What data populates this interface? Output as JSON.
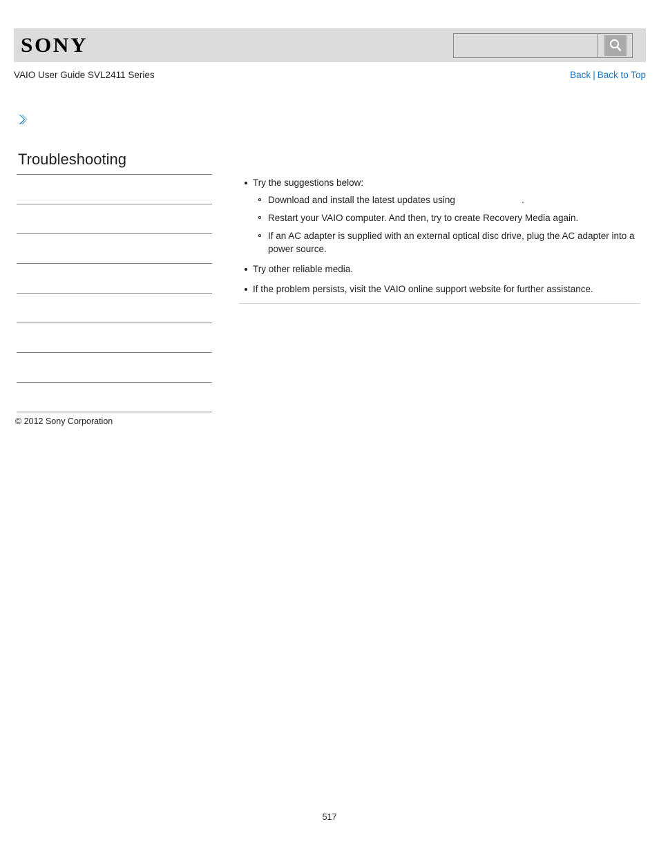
{
  "header": {
    "logo_text": "SONY",
    "logo_icon": "sony-wordmark",
    "search": {
      "value": "",
      "placeholder": "",
      "icon": "search-icon",
      "button_label": ""
    }
  },
  "subheader": {
    "guide_title": "VAIO User Guide SVL2411 Series",
    "links": {
      "back": "Back",
      "separator": "|",
      "back_to_top": "Back to Top"
    }
  },
  "breadcrumb": {
    "icon": "chevron-right-icon",
    "accent_color": "#2f8fd0"
  },
  "sidebar": {
    "section_title": "Troubleshooting",
    "items": [
      {
        "label": ""
      },
      {
        "label": ""
      },
      {
        "label": ""
      },
      {
        "label": ""
      },
      {
        "label": ""
      },
      {
        "label": ""
      },
      {
        "label": ""
      },
      {
        "label": ""
      }
    ]
  },
  "main": {
    "bullets": [
      {
        "text": "Try the suggestions below:",
        "sub": [
          {
            "before": "Download and install the latest updates using",
            "link": "",
            "after": "."
          },
          {
            "before": "Restart your VAIO computer. And then, try to create Recovery Media again.",
            "link": "",
            "after": ""
          },
          {
            "before": "If an AC adapter is supplied with an external optical disc drive, plug the AC adapter into a power source.",
            "link": "",
            "after": ""
          }
        ]
      },
      {
        "text": "Try other reliable media.",
        "sub": []
      },
      {
        "text": "If the problem persists, visit the VAIO online support website for further assistance.",
        "sub": []
      }
    ]
  },
  "footer": {
    "copyright": "© 2012 Sony Corporation",
    "page_number": "517"
  },
  "colors": {
    "link": "#1672c4",
    "header_band": "#dcdcdc",
    "rule": "#808080",
    "text": "#231f20"
  }
}
